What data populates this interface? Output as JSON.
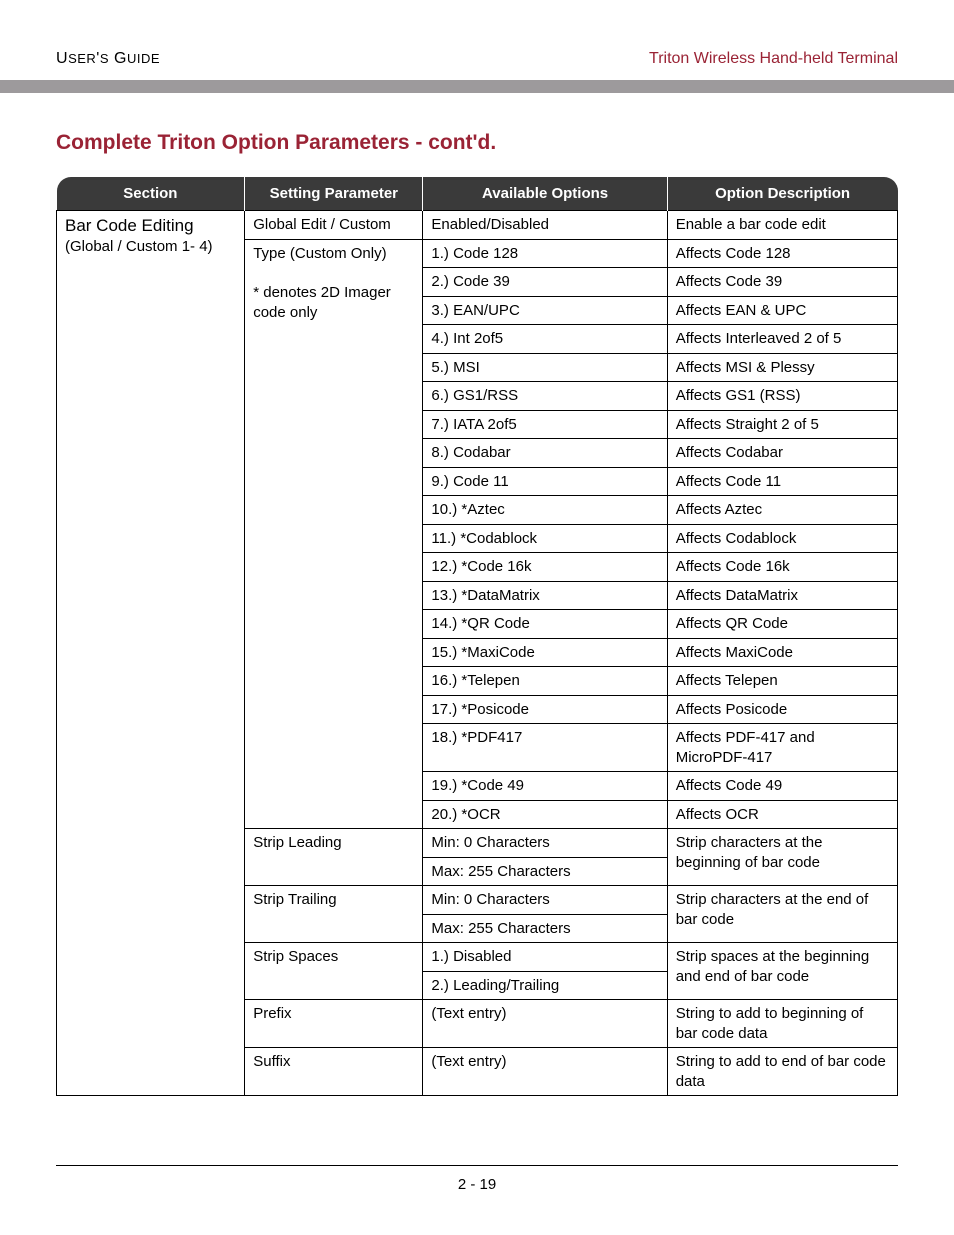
{
  "header": {
    "left": "USER'S GUIDE",
    "right": "Triton Wireless Hand-held Terminal"
  },
  "title": "Complete Triton Option Parameters - cont'd.",
  "columns": {
    "section": "Section",
    "param": "Setting Parameter",
    "options": "Available Options",
    "desc": "Option Description"
  },
  "section": {
    "main": "Bar Code Editing",
    "sub": "(Global / Custom 1- 4)"
  },
  "params": {
    "global_edit": "Global Edit / Custom",
    "type_custom": "Type (Custom Only)",
    "type_note": "* denotes 2D Imager code only",
    "strip_leading": "Strip Leading",
    "strip_trailing": "Strip Trailing",
    "strip_spaces": "Strip Spaces",
    "prefix": "Prefix",
    "suffix": "Suffix"
  },
  "global_edit_row": {
    "option": "Enabled/Disabled",
    "desc": "Enable a bar code edit"
  },
  "type_rows": [
    {
      "option": "1.) Code 128",
      "desc": "Affects Code 128"
    },
    {
      "option": "2.) Code 39",
      "desc": "Affects Code 39"
    },
    {
      "option": "3.) EAN/UPC",
      "desc": "Affects EAN & UPC"
    },
    {
      "option": "4.) Int 2of5",
      "desc": "Affects Interleaved 2 of 5"
    },
    {
      "option": "5.) MSI",
      "desc": "Affects MSI & Plessy"
    },
    {
      "option": "6.) GS1/RSS",
      "desc": "Affects GS1 (RSS)"
    },
    {
      "option": "7.) IATA 2of5",
      "desc": "Affects Straight 2 of 5"
    },
    {
      "option": "8.) Codabar",
      "desc": "Affects Codabar"
    },
    {
      "option": "9.) Code 11",
      "desc": "Affects Code 11"
    },
    {
      "option": "10.) *Aztec",
      "desc": "Affects Aztec"
    },
    {
      "option": "11.) *Codablock",
      "desc": "Affects Codablock"
    },
    {
      "option": "12.) *Code 16k",
      "desc": "Affects Code 16k"
    },
    {
      "option": "13.) *DataMatrix",
      "desc": "Affects DataMatrix"
    },
    {
      "option": "14.) *QR Code",
      "desc": "Affects QR Code"
    },
    {
      "option": "15.) *MaxiCode",
      "desc": "Affects MaxiCode"
    },
    {
      "option": "16.) *Telepen",
      "desc": "Affects Telepen"
    },
    {
      "option": "17.) *Posicode",
      "desc": "Affects Posicode"
    },
    {
      "option": "18.) *PDF417",
      "desc": "Affects PDF-417 and MicroPDF-417"
    },
    {
      "option": "19.) *Code 49",
      "desc": "Affects Code 49"
    },
    {
      "option": "20.) *OCR",
      "desc": "Affects OCR"
    }
  ],
  "strip_leading_rows": {
    "opt1": "Min: 0 Characters",
    "opt2": "Max: 255 Characters",
    "desc": "Strip characters at the beginning of bar code"
  },
  "strip_trailing_rows": {
    "opt1": "Min: 0 Characters",
    "opt2": "Max: 255 Characters",
    "desc": "Strip characters at the end of bar code"
  },
  "strip_spaces_rows": {
    "opt1": "1.) Disabled",
    "opt2": "2.) Leading/Trailing",
    "desc": "Strip spaces at the beginning and end of bar code"
  },
  "prefix_row": {
    "option": "(Text entry)",
    "desc": "String to add to beginning of bar code data"
  },
  "suffix_row": {
    "option": "(Text entry)",
    "desc": "String to add to end of bar code data"
  },
  "footer": "2 - 19"
}
